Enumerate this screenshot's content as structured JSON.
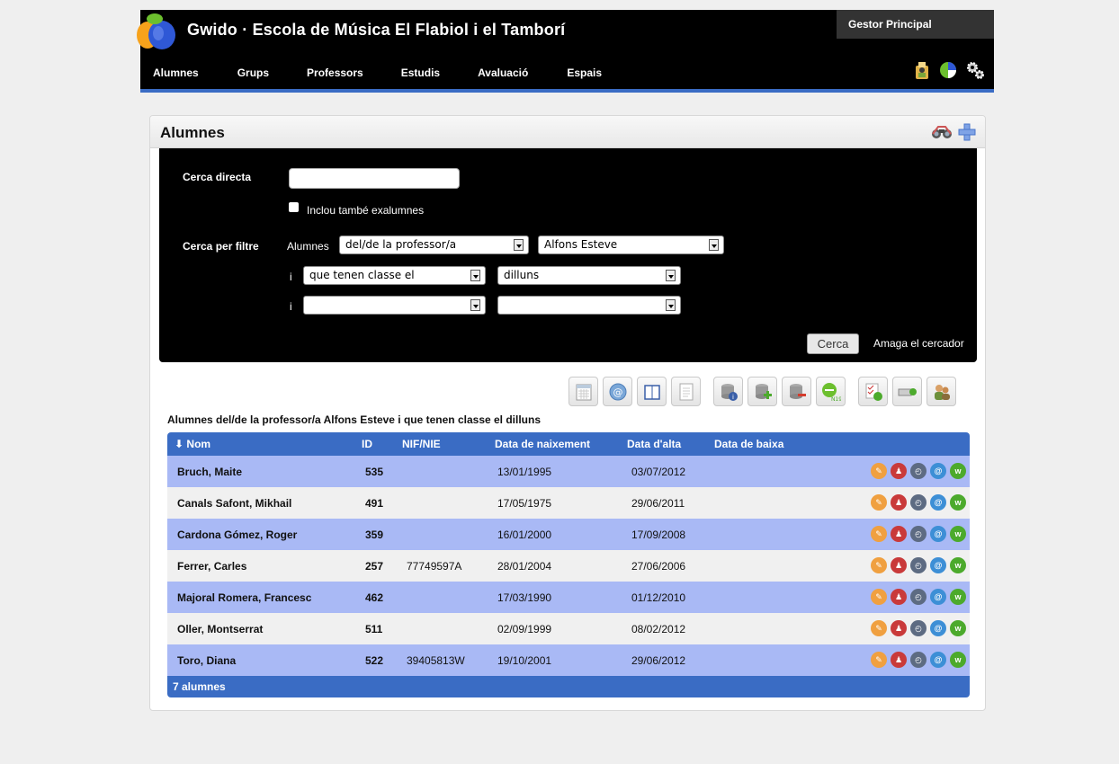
{
  "header": {
    "title": "Gwido · Escola de Música El Flabiol i el Tamborí",
    "manager": "Gestor Principal",
    "nav": [
      "Alumnes",
      "Grups",
      "Professors",
      "Estudis",
      "Avaluació",
      "Espais"
    ]
  },
  "panel": {
    "title": "Alumnes"
  },
  "search": {
    "direct_label": "Cerca directa",
    "direct_value": "",
    "include_former_label": "Inclou també exalumnes",
    "include_former_checked": false,
    "filter_label": "Cerca per filtre",
    "filter_prefix": "Alumnes",
    "row1": {
      "field": "del/de la professor/a",
      "value": "Alfons Esteve"
    },
    "row2": {
      "conj": "i",
      "field": "que tenen classe el",
      "value": "dilluns"
    },
    "row3": {
      "conj": "i",
      "field": "",
      "value": ""
    },
    "search_button": "Cerca",
    "hide_link": "Amaga el cercador"
  },
  "results": {
    "caption": "Alumnes del/de la professor/a Alfons Esteve i que tenen classe el dilluns",
    "columns": [
      "Nom",
      "ID",
      "NIF/NIE",
      "Data de naixement",
      "Data d'alta",
      "Data de baixa"
    ],
    "rows": [
      {
        "name": "Bruch, Maite",
        "id": "535",
        "nif": "",
        "birth": "13/01/1995",
        "start": "03/07/2012",
        "end": ""
      },
      {
        "name": "Canals Safont, Mikhail",
        "id": "491",
        "nif": "",
        "birth": "17/05/1975",
        "start": "29/06/2011",
        "end": ""
      },
      {
        "name": "Cardona Gómez, Roger",
        "id": "359",
        "nif": "",
        "birth": "16/01/2000",
        "start": "17/09/2008",
        "end": ""
      },
      {
        "name": "Ferrer, Carles",
        "id": "257",
        "nif": "77749597A",
        "birth": "28/01/2004",
        "start": "27/06/2006",
        "end": ""
      },
      {
        "name": "Majoral Romera, Francesc",
        "id": "462",
        "nif": "",
        "birth": "17/03/1990",
        "start": "01/12/2010",
        "end": ""
      },
      {
        "name": "Oller, Montserrat",
        "id": "511",
        "nif": "",
        "birth": "02/09/1999",
        "start": "08/02/2012",
        "end": ""
      },
      {
        "name": "Toro, Diana",
        "id": "522",
        "nif": "39405813W",
        "birth": "19/10/2001",
        "start": "29/06/2012",
        "end": ""
      }
    ],
    "footer": "7 alumnes"
  },
  "colors": {
    "accent": "#3a6cc4",
    "row_odd": "#a9b9f5",
    "row_even": "#f0f0f0"
  }
}
